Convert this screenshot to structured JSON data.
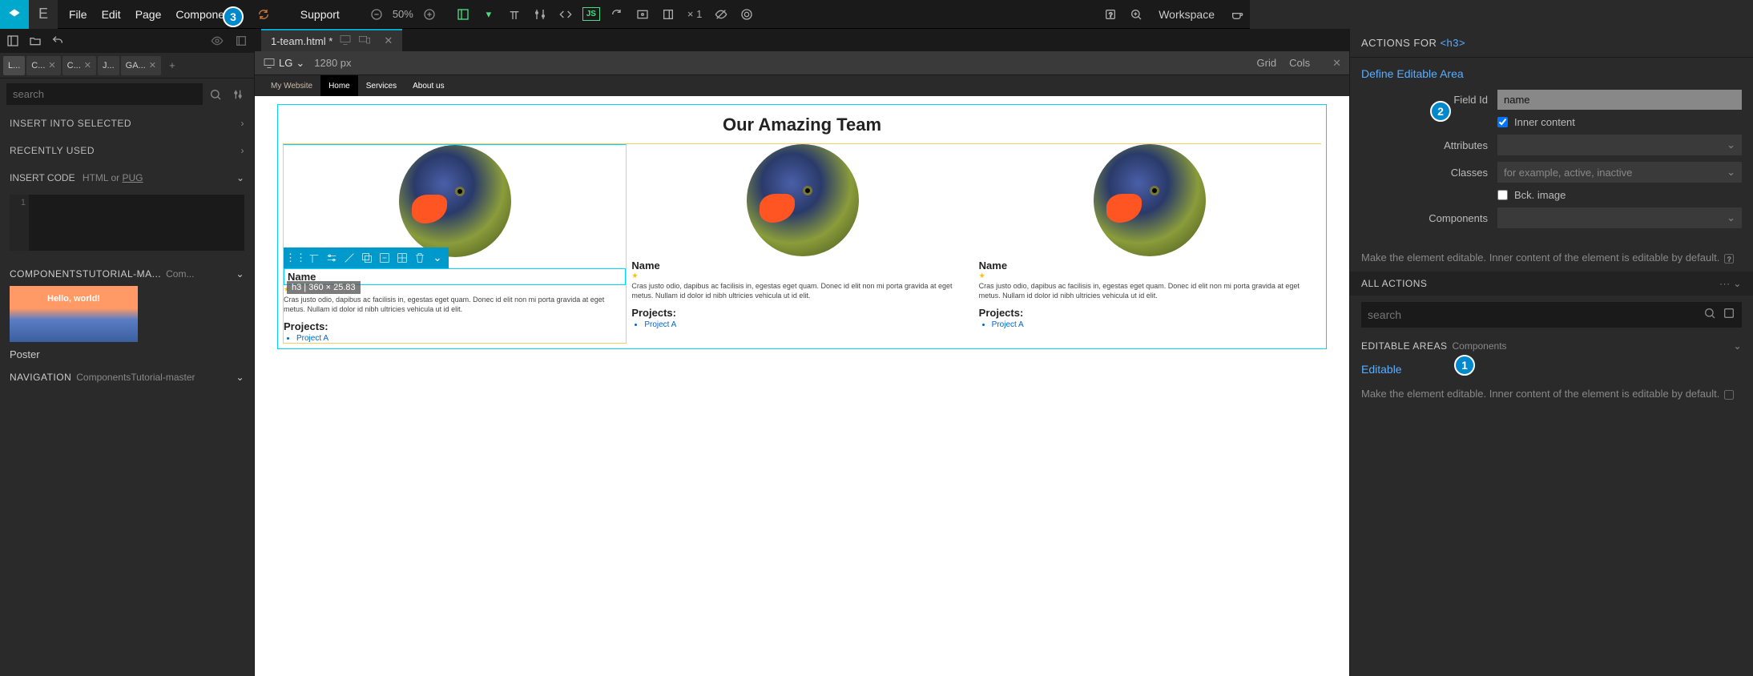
{
  "topbar": {
    "menus": [
      "File",
      "Edit",
      "Page",
      "Components",
      "Support"
    ],
    "zoom": "50%",
    "x1": "× 1",
    "workspace": "Workspace"
  },
  "doc_tab": {
    "name": "1-team.html *"
  },
  "left": {
    "tabs": [
      "L...",
      "C...",
      "C...",
      "J...",
      "GA..."
    ],
    "search_placeholder": "search",
    "insert_into": "INSERT INTO SELECTED",
    "recently_used": "RECENTLY USED",
    "insert_code": "INSERT CODE",
    "insert_code_sub": "HTML or PUG",
    "code_line": "1",
    "comp_tutorial": "COMPONENTSTUTORIAL-MA...",
    "comp_sub": "Com...",
    "poster_hello": "Hello, world!",
    "poster_label": "Poster",
    "nav_label": "NAVIGATION",
    "nav_sub": "ComponentsTutorial-master"
  },
  "center": {
    "device": "LG",
    "width": "1280 px",
    "grid": "Grid",
    "cols": "Cols",
    "nav_items": [
      "My Website",
      "Home",
      "Services",
      "About us"
    ],
    "page_title": "Our Amazing Team",
    "h3_info": "h3 | 360 × 25.83",
    "member": {
      "name": "Name",
      "desc": "Cras justo odio, dapibus ac facilisis in, egestas eget quam. Donec id elit non mi porta gravida at eget metus. Nullam id dolor id nibh ultricies vehicula ut id elit.",
      "projects": "Projects:",
      "project_a": "Project A"
    }
  },
  "right": {
    "actions_for": "ACTIONS FOR",
    "actions_tag": "<h3>",
    "define_editable": "Define Editable Area",
    "field_id_label": "Field Id",
    "field_id_value": "name",
    "inner_content": "Inner content",
    "attributes_label": "Attributes",
    "classes_label": "Classes",
    "classes_placeholder": "for example, active, inactive",
    "bck_image": "Bck. image",
    "components_label": "Components",
    "hint": "Make the element editable. Inner content of the element is editable by default.",
    "all_actions": "ALL ACTIONS",
    "search_placeholder": "search",
    "editable_areas": "EDITABLE AREAS",
    "editable_areas_sub": "Components",
    "editable_link": "Editable"
  },
  "steps": {
    "s1": "1",
    "s2": "2",
    "s3": "3"
  }
}
